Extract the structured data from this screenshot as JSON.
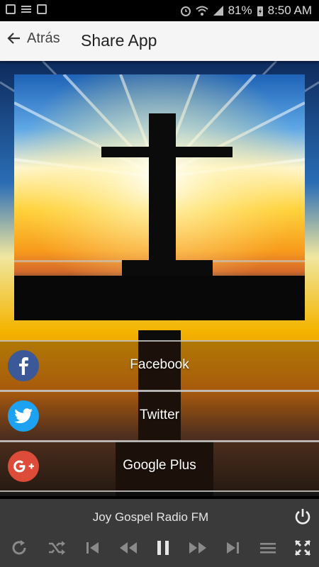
{
  "status_bar": {
    "battery": "81%",
    "time": "8:50 AM"
  },
  "app_bar": {
    "back_label": "Atrás",
    "title": "Share App"
  },
  "share_options": [
    {
      "label": "Facebook",
      "icon": "facebook-icon",
      "color": "#3b5998"
    },
    {
      "label": "Twitter",
      "icon": "twitter-icon",
      "color": "#1da1f2"
    },
    {
      "label": "Google Plus",
      "icon": "google-plus-icon",
      "color": "#dd4b39"
    }
  ],
  "player": {
    "station": "Joy Gospel Radio FM",
    "controls": [
      "repeat-icon",
      "shuffle-icon",
      "skip-previous-icon",
      "rewind-icon",
      "pause-icon",
      "fast-forward-icon",
      "skip-next-icon",
      "playlist-icon",
      "fullscreen-icon"
    ],
    "power_icon": "power-icon"
  },
  "colors": {
    "appbar_bg": "#f5f5f5",
    "player_bg": "#3a3a3a",
    "sky_top": "#1b5fae",
    "sky_horizon": "#f4b400"
  }
}
